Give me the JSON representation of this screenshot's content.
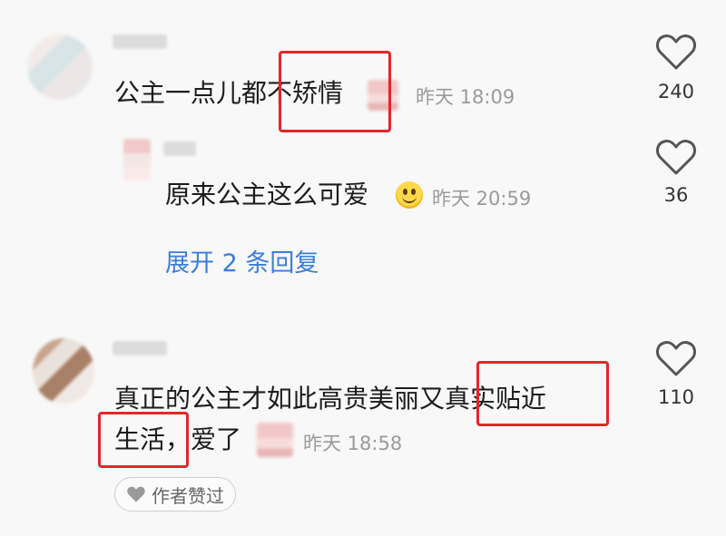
{
  "comments": [
    {
      "text": "公主一点儿都不矫情",
      "time": "昨天 18:09",
      "likes": "240"
    },
    {
      "text": "原来公主这么可爱",
      "time": "昨天 20:59",
      "likes": "36",
      "emoji": "smile"
    },
    {
      "expand_label": "展开 2 条回复"
    },
    {
      "text_line1": "真正的公主才如此高贵美丽又真实贴近",
      "text_line2": "生活，爱了",
      "time": "昨天 18:58",
      "likes": "110",
      "author_like_label": "作者赞过"
    }
  ],
  "colors": {
    "highlight_box": "#e3262a",
    "link": "#3b7dd8",
    "muted": "#9a9a9a"
  }
}
